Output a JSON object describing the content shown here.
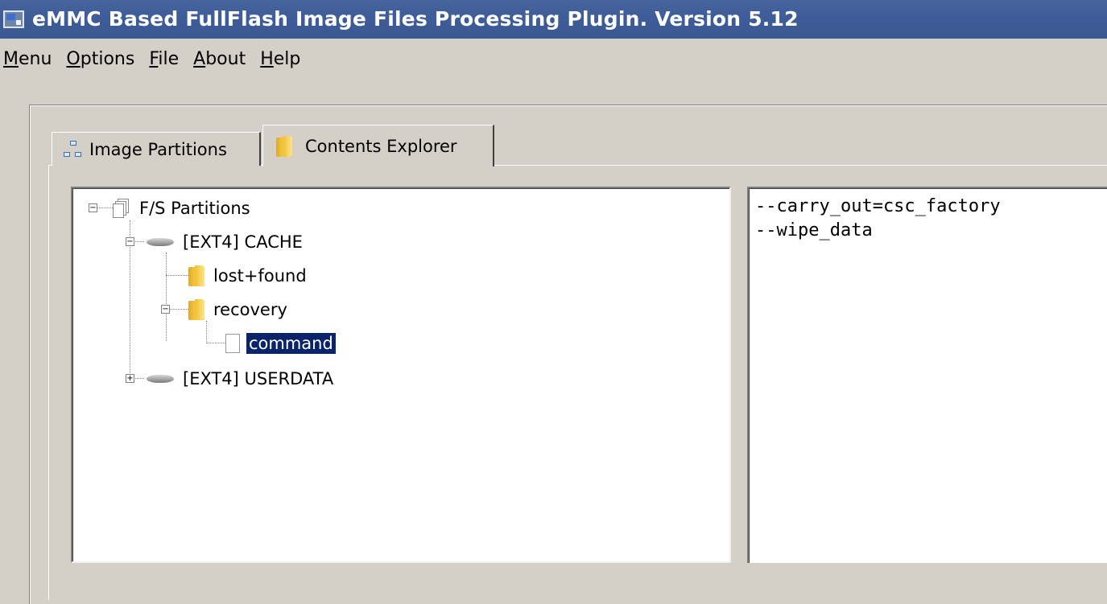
{
  "window": {
    "title": "eMMC Based FullFlash Image Files Processing Plugin. Version 5.12",
    "icon": "app-window-icon"
  },
  "menubar": {
    "items": [
      {
        "label": "Menu",
        "mnemonic": "M"
      },
      {
        "label": "Options",
        "mnemonic": "O"
      },
      {
        "label": "File",
        "mnemonic": "F"
      },
      {
        "label": "About",
        "mnemonic": "A"
      },
      {
        "label": "Help",
        "mnemonic": "H"
      }
    ]
  },
  "tabs": [
    {
      "label": "Image Partitions",
      "icon": "network-icon",
      "active": false
    },
    {
      "label": "Contents Explorer",
      "icon": "folder-icon",
      "active": true
    }
  ],
  "tree": {
    "root": {
      "label": "F/S Partitions",
      "icon": "partitions-icon",
      "expanded": true
    },
    "nodes": [
      {
        "label": "[EXT4] CACHE",
        "icon": "disk-icon",
        "expanded": true
      },
      {
        "label": "lost+found",
        "icon": "folder-icon"
      },
      {
        "label": "recovery",
        "icon": "folder-icon",
        "expanded": true
      },
      {
        "label": "command",
        "icon": "file-icon",
        "selected": true
      },
      {
        "label": "[EXT4] USERDATA",
        "icon": "disk-icon",
        "expanded": false
      }
    ]
  },
  "file_view": {
    "lines": [
      "--carry_out=csc_factory",
      "--wipe_data"
    ]
  },
  "colors": {
    "titlebar": "#3e5d99",
    "window_bg": "#d4d0c8",
    "selection": "#0a246a"
  }
}
